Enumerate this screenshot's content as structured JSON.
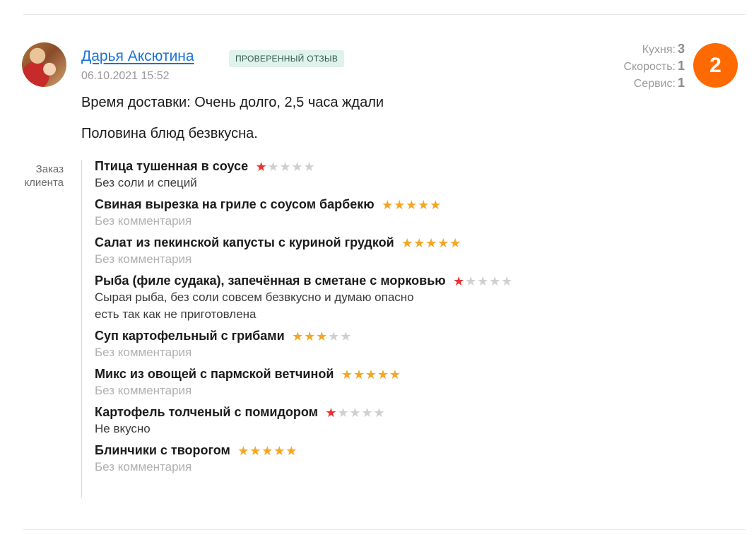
{
  "review": {
    "author": "Дарья Аксютина",
    "badge": "ПРОВЕРЕННЫЙ ОТЗЫВ",
    "date": "06.10.2021 15:52",
    "text_line1": "Время доставки: Очень долго, 2,5 часа ждали",
    "text_line2": "Половина блюд безвкусна."
  },
  "metrics": {
    "kitchen_label": "Кухня:",
    "kitchen_value": "3",
    "speed_label": "Скорость:",
    "speed_value": "1",
    "service_label": "Сервис:",
    "service_value": "1"
  },
  "score": "2",
  "order": {
    "label_line1": "Заказ",
    "label_line2": "клиента",
    "dishes": [
      {
        "name": "Птица тушенная в соусе",
        "rating": 1,
        "comment": "Без соли и специй",
        "has_comment": true
      },
      {
        "name": "Свиная вырезка на гриле с соусом барбекю",
        "rating": 5,
        "comment": "Без комментария",
        "has_comment": false
      },
      {
        "name": "Салат из пекинской капусты с куриной грудкой",
        "rating": 5,
        "comment": "Без комментария",
        "has_comment": false
      },
      {
        "name": "Рыба (филе судака), запечённая в сметане с морковью",
        "rating": 1,
        "comment": "Сырая рыба, без соли совсем безвкусно и думаю опасно\nесть так как не приготовлена",
        "has_comment": true
      },
      {
        "name": "Суп картофельный с грибами",
        "rating": 3,
        "comment": "Без комментария",
        "has_comment": false
      },
      {
        "name": "Микс из овощей с пармской ветчиной",
        "rating": 5,
        "comment": "Без комментария",
        "has_comment": false
      },
      {
        "name": "Картофель толченый с помидором",
        "rating": 1,
        "comment": "Не вкусно",
        "has_comment": true
      },
      {
        "name": "Блинчики с творогом",
        "rating": 5,
        "comment": "Без комментария",
        "has_comment": false
      }
    ]
  },
  "colors": {
    "accent_orange": "#ff6a00",
    "link_blue": "#1a73d9",
    "star_gold": "#f5a623",
    "star_red": "#e8312e",
    "star_empty": "#cfcfcf"
  }
}
